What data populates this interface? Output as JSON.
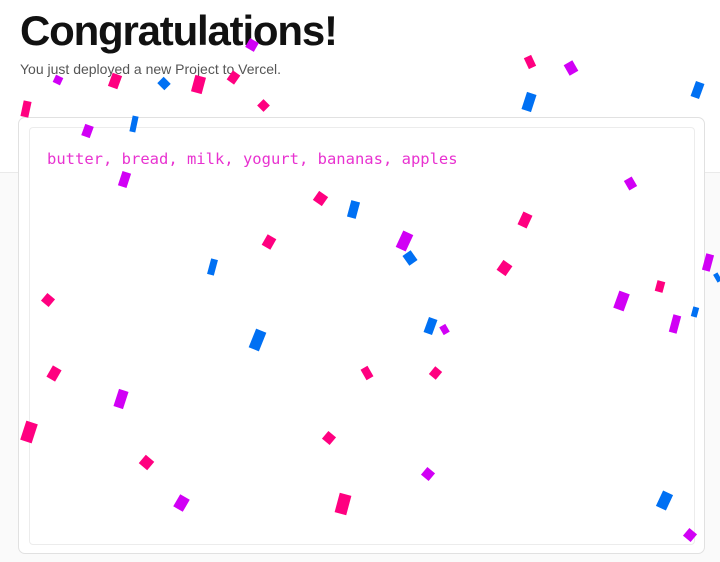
{
  "header": {
    "title": "Congratulations!",
    "subtitle": "You just deployed a new Project to Vercel."
  },
  "editor": {
    "text": "butter, bread, milk, yogurt, bananas, apples",
    "text_color": "#e832d0"
  },
  "colors": {
    "confetti_pink": "#ff0080",
    "confetti_purple": "#d100f5",
    "confetti_blue": "#0070f3"
  }
}
